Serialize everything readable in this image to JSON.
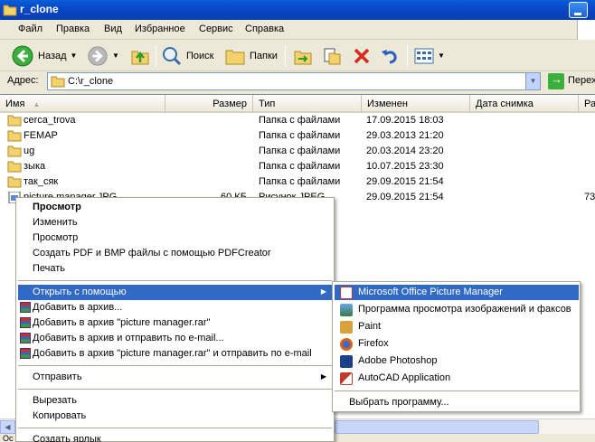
{
  "window": {
    "title": "r_clone"
  },
  "menubar": {
    "items": [
      "Файл",
      "Правка",
      "Вид",
      "Избранное",
      "Сервис",
      "Справка"
    ]
  },
  "toolbar": {
    "back_label": "Назад",
    "search_label": "Поиск",
    "folders_label": "Папки"
  },
  "address": {
    "label": "Адрес:",
    "value": "C:\\r_clone",
    "go_label": "Перех"
  },
  "columns": {
    "name": "Имя",
    "size": "Размер",
    "type": "Тип",
    "modified": "Изменен",
    "taken": "Дата снимка",
    "dimensions": "Ра"
  },
  "files": [
    {
      "name": "cerca_trova",
      "size": "",
      "type": "Папка с файлами",
      "modified": "17.09.2015 18:03",
      "extra": ""
    },
    {
      "name": "FEMAP",
      "size": "",
      "type": "Папка с файлами",
      "modified": "29.03.2013 21:20",
      "extra": ""
    },
    {
      "name": "ug",
      "size": "",
      "type": "Папка с файлами",
      "modified": "20.03.2014 23:20",
      "extra": ""
    },
    {
      "name": "зыка",
      "size": "",
      "type": "Папка с файлами",
      "modified": "10.07.2015 23:30",
      "extra": ""
    },
    {
      "name": "так_сяк",
      "size": "",
      "type": "Папка с файлами",
      "modified": "29.09.2015 21:54",
      "extra": ""
    },
    {
      "name": "picture manager.JPG",
      "size": "60 КБ",
      "type": "Рисунок JPEG",
      "modified": "29.09.2015 21:54",
      "extra": "73"
    }
  ],
  "context_menu": {
    "items": [
      {
        "label": "Просмотр",
        "bold": true
      },
      {
        "label": "Изменить"
      },
      {
        "label": "Просмотр"
      },
      {
        "label": "Создать PDF и BMP файлы с помощью PDFCreator"
      },
      {
        "label": "Печать"
      },
      {
        "label": "Открыть с помощью",
        "submenu": true,
        "highlighted": true
      },
      {
        "label": "Добавить в архив..."
      },
      {
        "label": "Добавить в архив \"picture manager.rar\""
      },
      {
        "label": "Добавить в архив и отправить по e-mail..."
      },
      {
        "label": "Добавить в архив \"picture manager.rar\" и отправить по e-mail"
      },
      {
        "label": "Отправить",
        "submenu": true
      },
      {
        "label": "Вырезать"
      },
      {
        "label": "Копировать"
      },
      {
        "label": "Создать ярлык"
      }
    ]
  },
  "open_with_menu": {
    "items": [
      {
        "label": "Microsoft Office Picture Manager",
        "icon": "picture-manager-icon",
        "color": "#c0392b"
      },
      {
        "label": "Программа просмотра изображений и факсов",
        "icon": "image-viewer-icon",
        "color": "#3a7a4a"
      },
      {
        "label": "Paint",
        "icon": "paint-icon",
        "color": "#d8a23a"
      },
      {
        "label": "Firefox",
        "icon": "firefox-icon",
        "color": "#e66000"
      },
      {
        "label": "Adobe Photoshop",
        "icon": "photoshop-icon",
        "color": "#1c3f8c"
      },
      {
        "label": "AutoCAD Application",
        "icon": "autocad-icon",
        "color": "#c0392b"
      }
    ],
    "choose_label": "Выбрать программу..."
  },
  "status": {
    "text": "Ос"
  },
  "colors": {
    "titlebar": "#0a48c8",
    "highlight": "#316ac5",
    "folder": "#f3d26b"
  }
}
